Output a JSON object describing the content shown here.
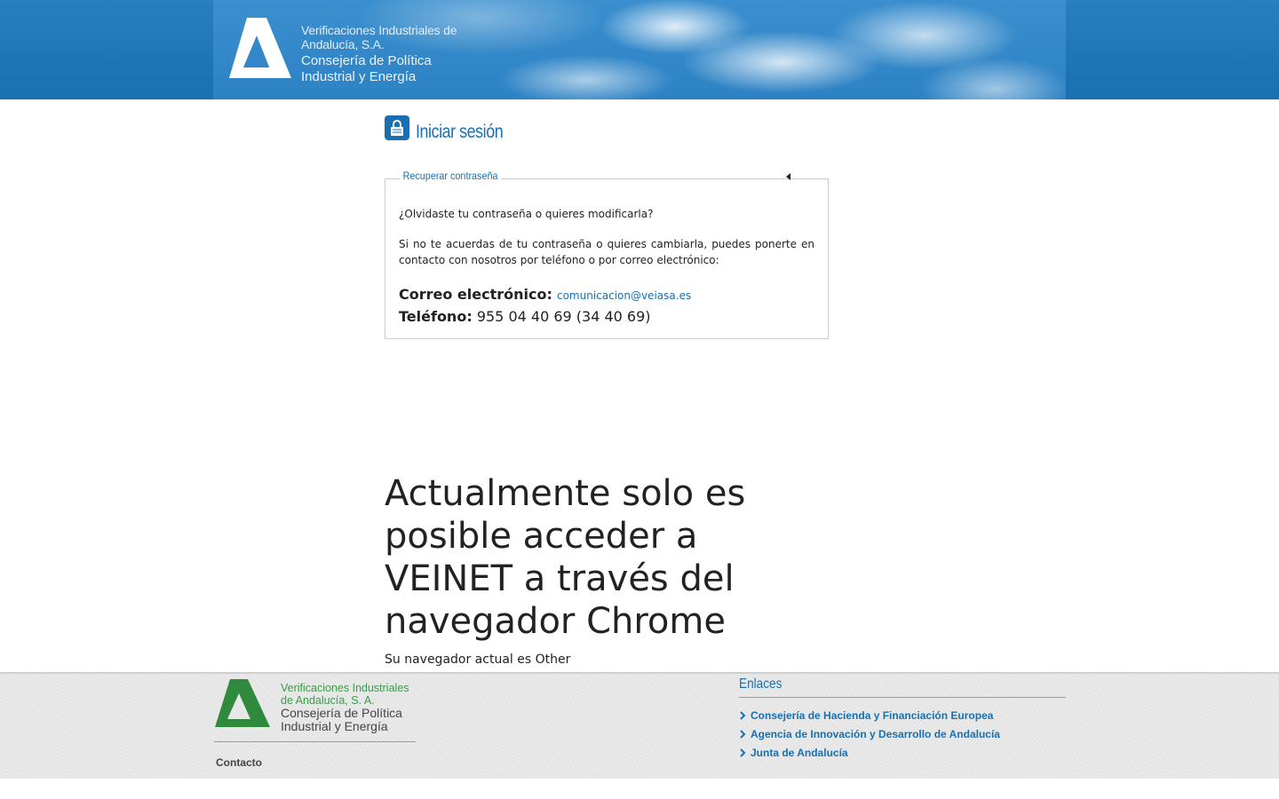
{
  "header": {
    "org_line1": "Verificaciones Industriales de",
    "org_line2": "Andalucía, S.A.",
    "dept_line1": "Consejería de Política",
    "dept_line2": "Industrial y Energía",
    "logo_icon": "junta-andalucia-logo-icon"
  },
  "login": {
    "title": "Iniciar sesión",
    "icon": "lock-icon"
  },
  "recover": {
    "legend": "Recuperar contraseña",
    "question": "¿Olvidaste tu contraseña o quieres modificarla?",
    "description": "Si no te acuerdas de tu contraseña o quieres cambiarla, puedes ponerte en contacto con nosotros por teléfono o por correo electrónico:",
    "email_label": "Correo electrónico:",
    "email_value": "comunicacion@veiasa.es",
    "phone_label": "Teléfono:",
    "phone_value": "955 04 40 69 (34 40 69)"
  },
  "warning": {
    "title": "Actualmente solo es posible acceder a VEINET a través del navegador Chrome",
    "subtitle": "Su navegador actual es Other"
  },
  "footer": {
    "org_line1": "Verificaciones Industriales",
    "org_line2": "de Andalucía, S. A.",
    "dept_line1": "Consejería de Política",
    "dept_line2": "Industrial y Energía",
    "contact": "Contacto",
    "links_title": "Enlaces",
    "links": [
      {
        "label": "Consejería de Hacienda y Financiación Europea"
      },
      {
        "label": "Agencia de Innovación y Desarrollo de Andalucía"
      },
      {
        "label": "Junta de Andalucía"
      }
    ]
  },
  "colors": {
    "brand_blue": "#1a6fb0",
    "brand_green": "#3d9a4a",
    "footer_bg": "#e4e4e4"
  }
}
